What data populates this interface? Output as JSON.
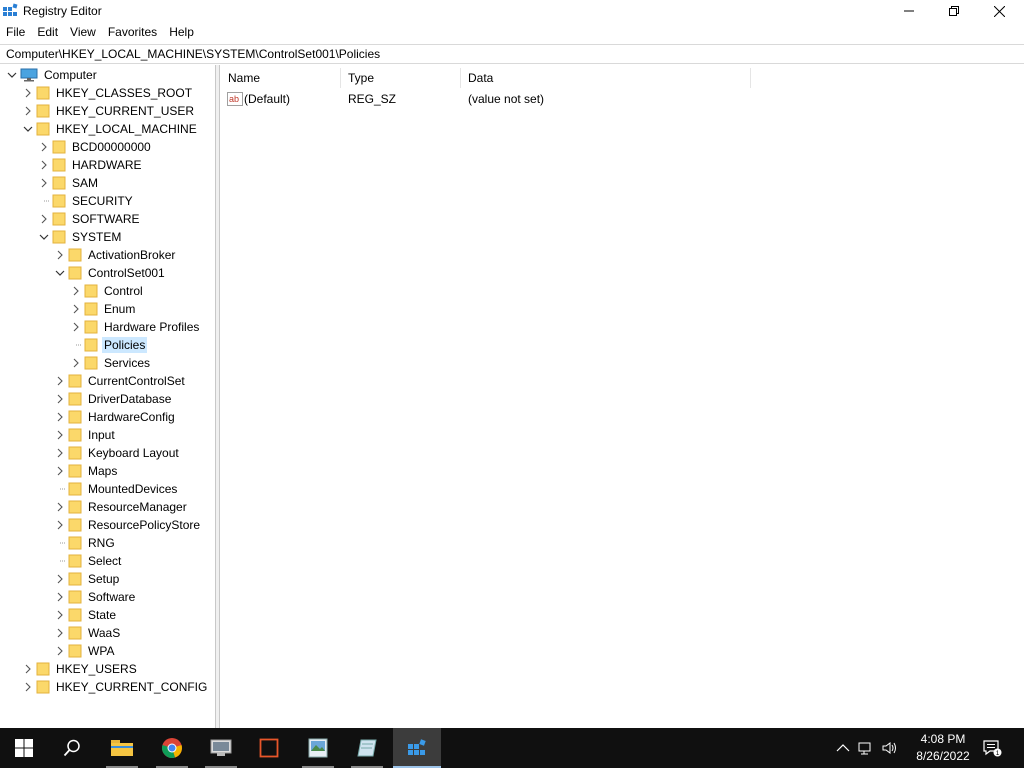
{
  "window": {
    "title": "Registry Editor",
    "controls": {
      "minimize": "minimize",
      "maximize": "restore",
      "close": "close"
    }
  },
  "menu": [
    {
      "label": "File"
    },
    {
      "label": "Edit"
    },
    {
      "label": "View"
    },
    {
      "label": "Favorites"
    },
    {
      "label": "Help"
    }
  ],
  "address": "Computer\\HKEY_LOCAL_MACHINE\\SYSTEM\\ControlSet001\\Policies",
  "tree": {
    "root": "Computer",
    "nodes": [
      {
        "label": "HKEY_CLASSES_ROOT",
        "expander": "collapsed"
      },
      {
        "label": "HKEY_CURRENT_USER",
        "expander": "collapsed"
      },
      {
        "label": "HKEY_LOCAL_MACHINE",
        "expander": "expanded"
      },
      {
        "label": "BCD00000000",
        "expander": "collapsed"
      },
      {
        "label": "HARDWARE",
        "expander": "collapsed"
      },
      {
        "label": "SAM",
        "expander": "collapsed"
      },
      {
        "label": "SECURITY",
        "expander": "none"
      },
      {
        "label": "SOFTWARE",
        "expander": "collapsed"
      },
      {
        "label": "SYSTEM",
        "expander": "expanded"
      },
      {
        "label": "ActivationBroker",
        "expander": "collapsed"
      },
      {
        "label": "ControlSet001",
        "expander": "expanded"
      },
      {
        "label": "Control",
        "expander": "collapsed"
      },
      {
        "label": "Enum",
        "expander": "collapsed"
      },
      {
        "label": "Hardware Profiles",
        "expander": "collapsed"
      },
      {
        "label": "Policies",
        "expander": "none",
        "selected": true
      },
      {
        "label": "Services",
        "expander": "collapsed"
      },
      {
        "label": "CurrentControlSet",
        "expander": "collapsed"
      },
      {
        "label": "DriverDatabase",
        "expander": "collapsed"
      },
      {
        "label": "HardwareConfig",
        "expander": "collapsed"
      },
      {
        "label": "Input",
        "expander": "collapsed"
      },
      {
        "label": "Keyboard Layout",
        "expander": "collapsed"
      },
      {
        "label": "Maps",
        "expander": "collapsed"
      },
      {
        "label": "MountedDevices",
        "expander": "none"
      },
      {
        "label": "ResourceManager",
        "expander": "collapsed"
      },
      {
        "label": "ResourcePolicyStore",
        "expander": "collapsed"
      },
      {
        "label": "RNG",
        "expander": "none"
      },
      {
        "label": "Select",
        "expander": "none"
      },
      {
        "label": "Setup",
        "expander": "collapsed"
      },
      {
        "label": "Software",
        "expander": "collapsed"
      },
      {
        "label": "State",
        "expander": "collapsed"
      },
      {
        "label": "WaaS",
        "expander": "collapsed"
      },
      {
        "label": "WPA",
        "expander": "collapsed"
      },
      {
        "label": "HKEY_USERS",
        "expander": "collapsed"
      },
      {
        "label": "HKEY_CURRENT_CONFIG",
        "expander": "collapsed"
      }
    ]
  },
  "list": {
    "columns": [
      "Name",
      "Type",
      "Data"
    ],
    "rows": [
      {
        "name": "(Default)",
        "type": "REG_SZ",
        "data": "(value not set)",
        "icon": "string-value-icon"
      }
    ]
  },
  "taskbar": {
    "apps": [
      {
        "name": "start-button",
        "icon": "windows-logo-icon"
      },
      {
        "name": "search-button",
        "icon": "search-icon"
      },
      {
        "name": "file-explorer",
        "icon": "folder-icon",
        "running": true
      },
      {
        "name": "chrome",
        "icon": "chrome-icon",
        "running": true
      },
      {
        "name": "app-monitor",
        "icon": "monitor-icon",
        "running": true
      },
      {
        "name": "app-orange-square",
        "icon": "square-icon",
        "running": false
      },
      {
        "name": "app-picture",
        "icon": "picture-icon",
        "running": true
      },
      {
        "name": "app-notebook",
        "icon": "notebook-icon",
        "running": true
      },
      {
        "name": "registry-editor",
        "icon": "regedit-icon",
        "running": true,
        "active": true
      }
    ],
    "clock": {
      "time": "4:08 PM",
      "date": "8/26/2022"
    },
    "notification_count": "1"
  }
}
